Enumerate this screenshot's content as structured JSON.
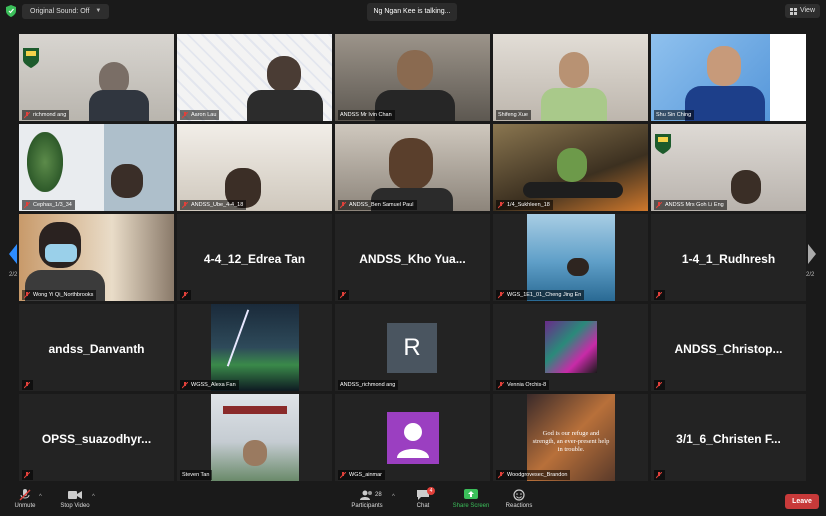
{
  "topbar": {
    "sound_label": "Original Sound: Off",
    "talking": "Ng Ngan Kee is talking...",
    "view_label": "View"
  },
  "nav": {
    "left_page": "2/2",
    "right_page": "2/2"
  },
  "tiles": [
    {
      "name": "richmond ang",
      "big": ""
    },
    {
      "name": "Aaron Lau",
      "big": ""
    },
    {
      "name": "ANDSS Mr Ivin Chan",
      "big": ""
    },
    {
      "name": "Shifeng Xue",
      "big": ""
    },
    {
      "name": "Shu Sin Ching",
      "big": ""
    },
    {
      "name": "Cephas_1/3_34",
      "big": ""
    },
    {
      "name": "ANDSS_Ube_4-4_18",
      "big": ""
    },
    {
      "name": "ANDSS_Ben Samuel Paul",
      "big": ""
    },
    {
      "name": "1/4_Sukhleen_18",
      "big": ""
    },
    {
      "name": "ANDSS Mrs Goh Li Eng",
      "big": ""
    },
    {
      "name": "Wong Yi Qi_Northbrooks",
      "big": ""
    },
    {
      "name": "",
      "big": "4-4_12_Edrea Tan"
    },
    {
      "name": "",
      "big": "ANDSS_Kho Yua..."
    },
    {
      "name": "WGS_1E1_01_Cheng Jing En",
      "big": ""
    },
    {
      "name": "",
      "big": "1-4_1_Rudhresh"
    },
    {
      "name": "",
      "big": "andss_Danvanth"
    },
    {
      "name": "WGSS_Alexa Fan",
      "big": ""
    },
    {
      "name": "ANDSS_richmond ang",
      "big": "",
      "avatar_letter": "R"
    },
    {
      "name": "Vennia Orchis-8",
      "big": ""
    },
    {
      "name": "",
      "big": "ANDSS_Christop..."
    },
    {
      "name": "",
      "big": "OPSS_suazodhyr..."
    },
    {
      "name": "Steven Tan",
      "big": ""
    },
    {
      "name": "WGS_ainmar",
      "big": ""
    },
    {
      "name": "Woodgrovesec_Brandon",
      "big": "",
      "quote": "God is our refuge and strength, an ever-present help in trouble."
    },
    {
      "name": "",
      "big": "3/1_6_Christen  F..."
    }
  ],
  "bottombar": {
    "unmute": "Unmute",
    "stop_video": "Stop Video",
    "participants": "Participants",
    "participants_count": "28",
    "chat": "Chat",
    "chat_badge": "4",
    "share": "Share Screen",
    "reactions": "Reactions",
    "leave": "Leave"
  },
  "colors": {
    "share_green": "#3bbf5a",
    "leave_red": "#c83a3a",
    "mute_red": "#e2403a",
    "arrow_blue": "#2d8cff"
  }
}
